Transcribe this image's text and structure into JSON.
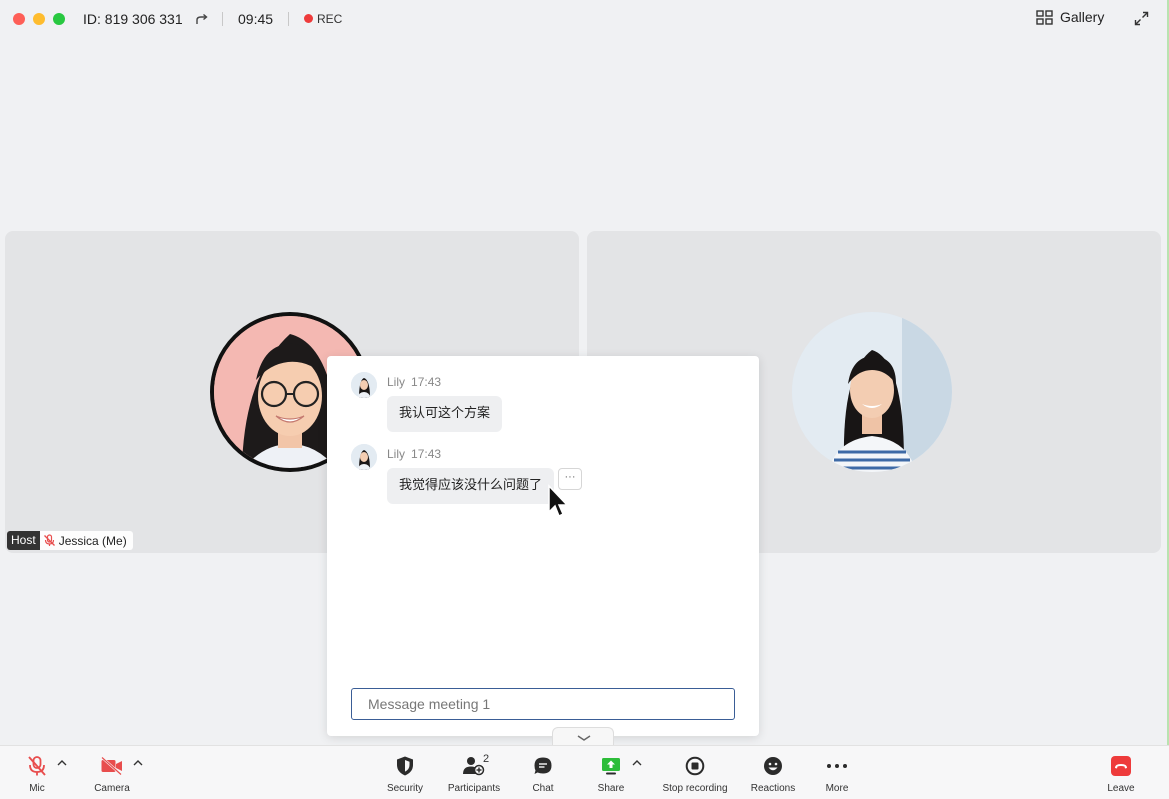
{
  "topbar": {
    "meeting_id": "ID: 819 306 331",
    "timer": "09:45",
    "rec_label": "REC",
    "gallery_label": "Gallery"
  },
  "tiles": {
    "host_badge": "Host",
    "self_name": "Jessica (Me)"
  },
  "chat": {
    "messages": [
      {
        "sender": "Lily",
        "time": "17:43",
        "text": "我认可这个方案"
      },
      {
        "sender": "Lily",
        "time": "17:43",
        "text": "我觉得应该没什么问题了"
      }
    ],
    "more_label": "···",
    "input_placeholder": "Message meeting 1"
  },
  "toolbar": {
    "mic": "Mic",
    "camera": "Camera",
    "security": "Security",
    "participants": "Participants",
    "participants_count": "2",
    "chat": "Chat",
    "share": "Share",
    "stop_recording": "Stop recording",
    "reactions": "Reactions",
    "more": "More",
    "leave": "Leave"
  },
  "colors": {
    "rec": "#ee3b3b",
    "muted": "#e84d4d",
    "share": "#2dbd3a",
    "leave": "#ee3b3b",
    "input_border": "#3a5d96"
  }
}
